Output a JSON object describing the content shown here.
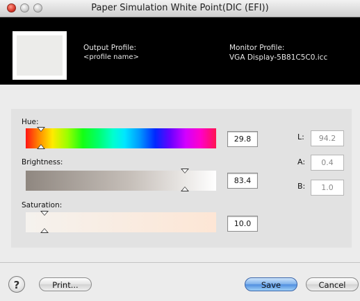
{
  "window": {
    "title": "Paper Simulation White Point(DIC (EFI))"
  },
  "header": {
    "output_profile_label": "Output Profile:",
    "output_profile_value": "<profile name>",
    "monitor_profile_label": "Monitor Profile:",
    "monitor_profile_value": "VGA Display-5B81C5C0.icc",
    "swatch_color": "#ececea"
  },
  "hue": {
    "label": "Hue:",
    "value": "29.8",
    "slider_fraction": 0.08
  },
  "brightness": {
    "label": "Brightness:",
    "value": "83.4",
    "slider_fraction": 0.834
  },
  "saturation": {
    "label": "Saturation:",
    "value": "10.0",
    "slider_fraction": 0.1
  },
  "lab": {
    "L": {
      "label": "L:",
      "value": "94.2"
    },
    "A": {
      "label": "A:",
      "value": "0.4"
    },
    "B": {
      "label": "B:",
      "value": "1.0"
    }
  },
  "buttons": {
    "help": "?",
    "print": "Print...",
    "save": "Save",
    "cancel": "Cancel"
  },
  "colors": {
    "default_button": "#4f8ee0",
    "header_band": "#000000"
  }
}
